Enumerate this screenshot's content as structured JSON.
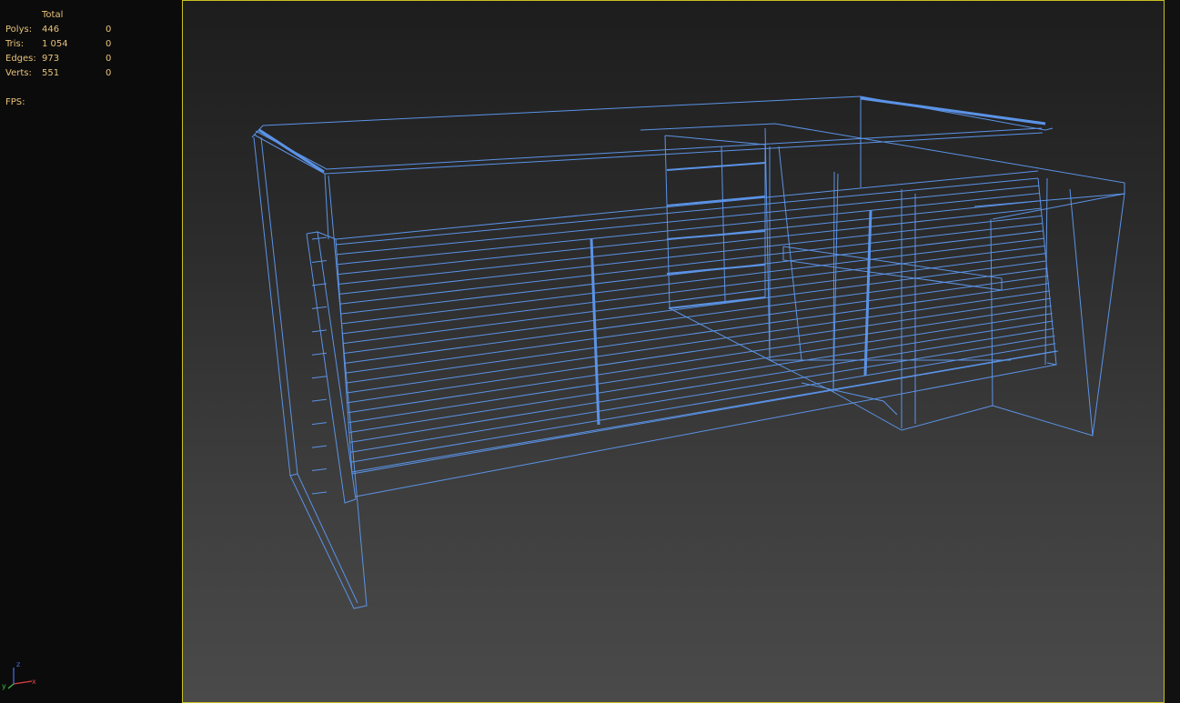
{
  "stats": {
    "header": "Total",
    "rows": [
      {
        "label": "Polys:",
        "total": "446",
        "selected": "0"
      },
      {
        "label": "Tris:",
        "total": "1 054",
        "selected": "0"
      },
      {
        "label": "Edges:",
        "total": "973",
        "selected": "0"
      },
      {
        "label": "Verts:",
        "total": "551",
        "selected": "0"
      }
    ],
    "fps_label": "FPS:"
  },
  "gizmo": {
    "x": "x",
    "y": "y",
    "z": "z"
  },
  "colors": {
    "wire": "#5b93e6",
    "stats_text": "#e6c27a",
    "viewport_border": "#c8c020"
  },
  "icons": {
    "axis_gizmo": "axis-tripod-icon"
  }
}
